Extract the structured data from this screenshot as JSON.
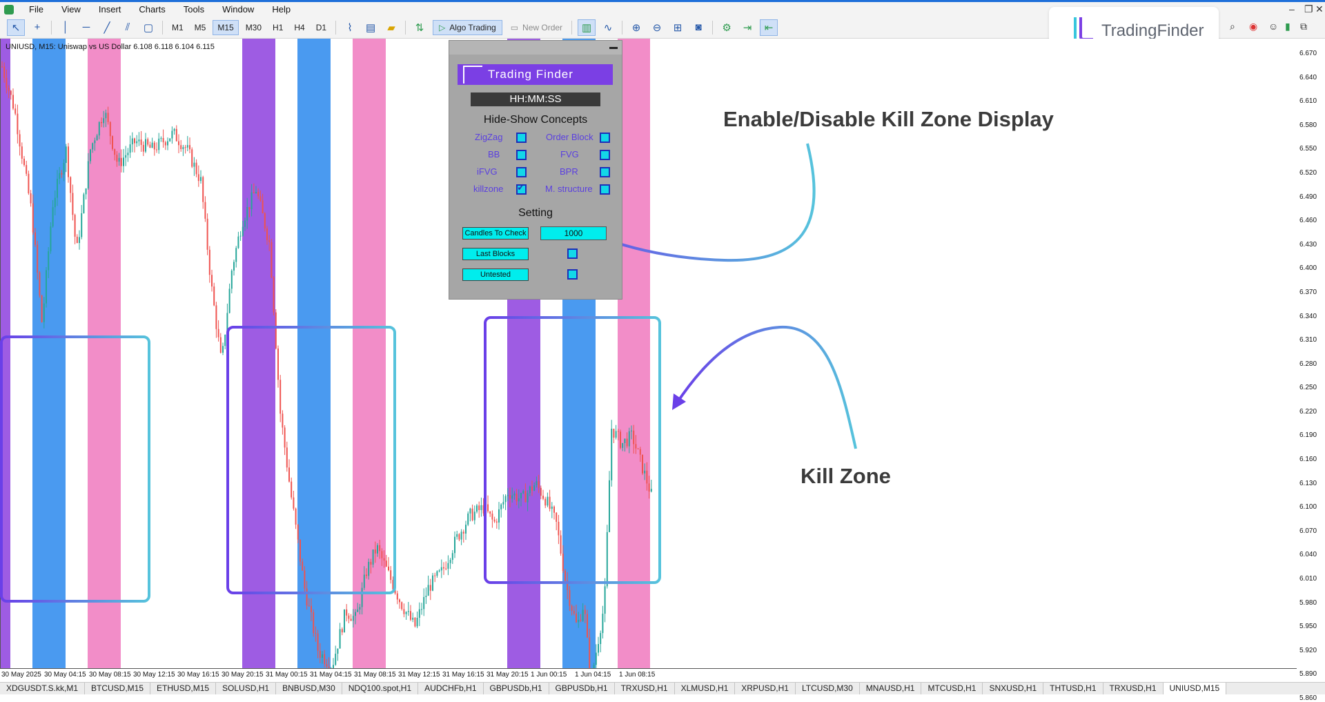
{
  "menu": [
    "File",
    "View",
    "Insert",
    "Charts",
    "Tools",
    "Window",
    "Help"
  ],
  "toolbar": {
    "timeframes": [
      "M1",
      "M5",
      "M15",
      "M30",
      "H1",
      "H4",
      "D1"
    ],
    "active_timeframe": "M15",
    "algo_trading": "Algo Trading",
    "new_order": "New Order"
  },
  "brand_logo_text": "TradingFinder",
  "chart": {
    "title": "UNIUSD, M15:  Uniswap vs US Dollar  6.108 6.118 6.104 6.115",
    "price_ticks": [
      "6.670",
      "6.640",
      "6.610",
      "6.580",
      "6.550",
      "6.520",
      "6.490",
      "6.460",
      "6.430",
      "6.400",
      "6.370",
      "6.340",
      "6.310",
      "6.280",
      "6.250",
      "6.220",
      "6.190",
      "6.160",
      "6.130",
      "6.100",
      "6.070",
      "6.040",
      "6.010",
      "5.980",
      "5.950",
      "5.920",
      "5.890",
      "5.860"
    ],
    "time_ticks": [
      "30 May 2025",
      "30 May 04:15",
      "30 May 08:15",
      "30 May 12:15",
      "30 May 16:15",
      "30 May 20:15",
      "31 May 00:15",
      "31 May 04:15",
      "31 May 08:15",
      "31 May 12:15",
      "31 May 16:15",
      "31 May 20:15",
      "1 Jun 00:15",
      "1 Jun 04:15",
      "1 Jun 08:15"
    ],
    "bull_color": "#26a69a",
    "bear_color": "#ef5350",
    "zone_colors": {
      "purple": "#9e5ce3",
      "blue": "#4a9af0",
      "pink": "#f28dc8"
    }
  },
  "panel": {
    "brand": "Trading Finder",
    "clock": "HH:MM:SS",
    "heading": "Hide-Show Concepts",
    "options_left": [
      {
        "label": "ZigZag",
        "checked": false
      },
      {
        "label": "BB",
        "checked": false
      },
      {
        "label": "iFVG",
        "checked": false
      },
      {
        "label": "killzone",
        "checked": true
      }
    ],
    "options_right": [
      {
        "label": "Order Block",
        "checked": false
      },
      {
        "label": "FVG",
        "checked": false
      },
      {
        "label": "BPR",
        "checked": false
      },
      {
        "label": "M. structure",
        "checked": false
      }
    ],
    "setting_heading": "Setting",
    "settings": [
      {
        "label": "Candles To Check",
        "value": "1000"
      },
      {
        "label": "Last Blocks",
        "value": ""
      },
      {
        "label": "Untested",
        "value": ""
      }
    ]
  },
  "annotations": {
    "enable_disable": "Enable/Disable Kill Zone Display",
    "kill_zone": "Kill Zone"
  },
  "tabs": [
    "XDGUSDT.S.kk,M1",
    "BTCUSD,M15",
    "ETHUSD,M15",
    "SOLUSD,H1",
    "BNBUSD,M30",
    "NDQ100.spot,H1",
    "AUDCHFb,H1",
    "GBPUSDb,H1",
    "GBPUSDb,H1",
    "TRXUSD,H1",
    "XLMUSD,H1",
    "XRPUSD,H1",
    "LTCUSD,M30",
    "MNAUSD,H1",
    "MTCUSD,H1",
    "SNXUSD,H1",
    "THTUSD,H1",
    "TRXUSD,H1",
    "UNIUSD,M15"
  ],
  "active_tab": "UNIUSD,M15"
}
